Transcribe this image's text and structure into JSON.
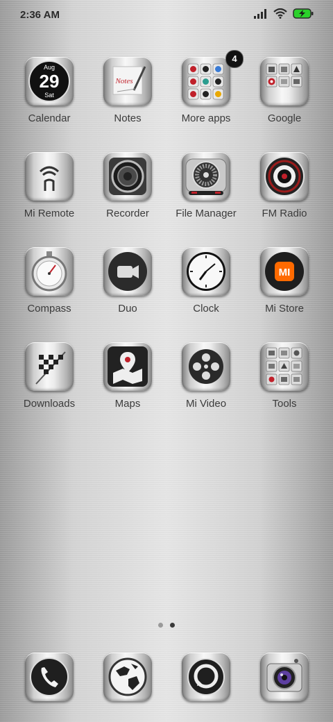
{
  "status_bar": {
    "time": "2:36 AM",
    "icons": [
      "signal-icon",
      "wifi-icon",
      "battery-charging-icon"
    ]
  },
  "calendar_icon": {
    "month": "Aug",
    "day": "29",
    "weekday": "Sat"
  },
  "notes_icon": {
    "script": "Notes"
  },
  "apps": [
    {
      "label": "Calendar",
      "icon": "calendar-icon"
    },
    {
      "label": "Notes",
      "icon": "notes-icon"
    },
    {
      "label": "More apps",
      "icon": "folder-icon",
      "badge": "4"
    },
    {
      "label": "Google",
      "icon": "google-folder-icon"
    },
    {
      "label": "Mi Remote",
      "icon": "remote-icon"
    },
    {
      "label": "Recorder",
      "icon": "speaker-icon"
    },
    {
      "label": "File Manager",
      "icon": "turbine-icon"
    },
    {
      "label": "FM Radio",
      "icon": "lens-icon"
    },
    {
      "label": "Compass",
      "icon": "stopwatch-icon"
    },
    {
      "label": "Duo",
      "icon": "video-camera-icon"
    },
    {
      "label": "Clock",
      "icon": "clock-icon"
    },
    {
      "label": "Mi Store",
      "icon": "mi-logo-icon"
    },
    {
      "label": "Downloads",
      "icon": "checkered-flag-icon"
    },
    {
      "label": "Maps",
      "icon": "map-pin-icon"
    },
    {
      "label": "Mi Video",
      "icon": "film-reel-icon"
    },
    {
      "label": "Tools",
      "icon": "tools-folder-icon"
    }
  ],
  "mi_store_icon": {
    "logo": "MI"
  },
  "page_indicator": {
    "pages": 2,
    "current": 2
  },
  "dock": [
    {
      "icon": "phone-icon"
    },
    {
      "icon": "globe-icon"
    },
    {
      "icon": "message-icon"
    },
    {
      "icon": "camera-icon"
    }
  ]
}
